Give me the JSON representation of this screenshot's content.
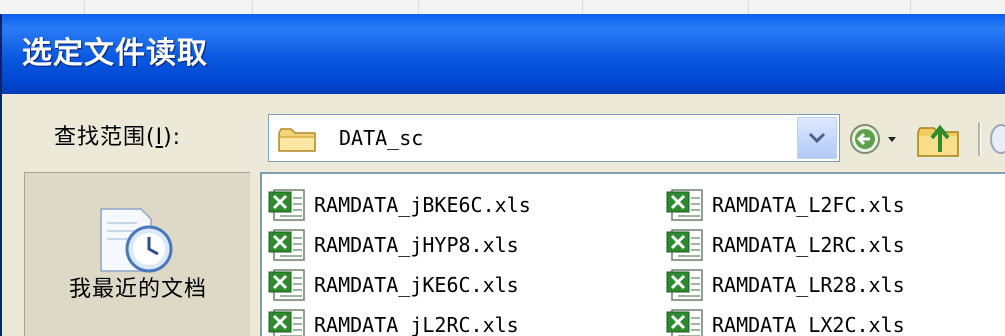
{
  "dialog": {
    "title": "选定文件读取"
  },
  "lookin": {
    "label_prefix": "查找范围(",
    "label_accel": "I",
    "label_suffix": "):",
    "current_folder": "DATA_sc",
    "folder_icon": "folder-icon",
    "dropdown_icon": "chevron-down-icon"
  },
  "toolbar": {
    "back_icon": "back-arrow-icon",
    "up_icon": "up-folder-icon"
  },
  "places": {
    "items": [
      {
        "label": "我最近的文档",
        "icon": "recent-documents-icon"
      }
    ]
  },
  "files": {
    "column1": [
      {
        "name": "RAMDATA_jBKE6C.xls",
        "icon": "excel-file-icon"
      },
      {
        "name": "RAMDATA_jHYP8.xls",
        "icon": "excel-file-icon"
      },
      {
        "name": "RAMDATA_jKE6C.xls",
        "icon": "excel-file-icon"
      },
      {
        "name": "RAMDATA_jL2RC.xls",
        "icon": "excel-file-icon"
      }
    ],
    "column2": [
      {
        "name": "RAMDATA_L2FC.xls",
        "icon": "excel-file-icon"
      },
      {
        "name": "RAMDATA_L2RC.xls",
        "icon": "excel-file-icon"
      },
      {
        "name": "RAMDATA_LR28.xls",
        "icon": "excel-file-icon"
      },
      {
        "name": "RAMDATA_LX2C.xls",
        "icon": "excel-file-icon"
      }
    ]
  },
  "colors": {
    "titlebar": "#0a58e0",
    "dialog_bg": "#ece9d8",
    "places_bg": "#ddd9c6",
    "border": "#7f9db9"
  }
}
